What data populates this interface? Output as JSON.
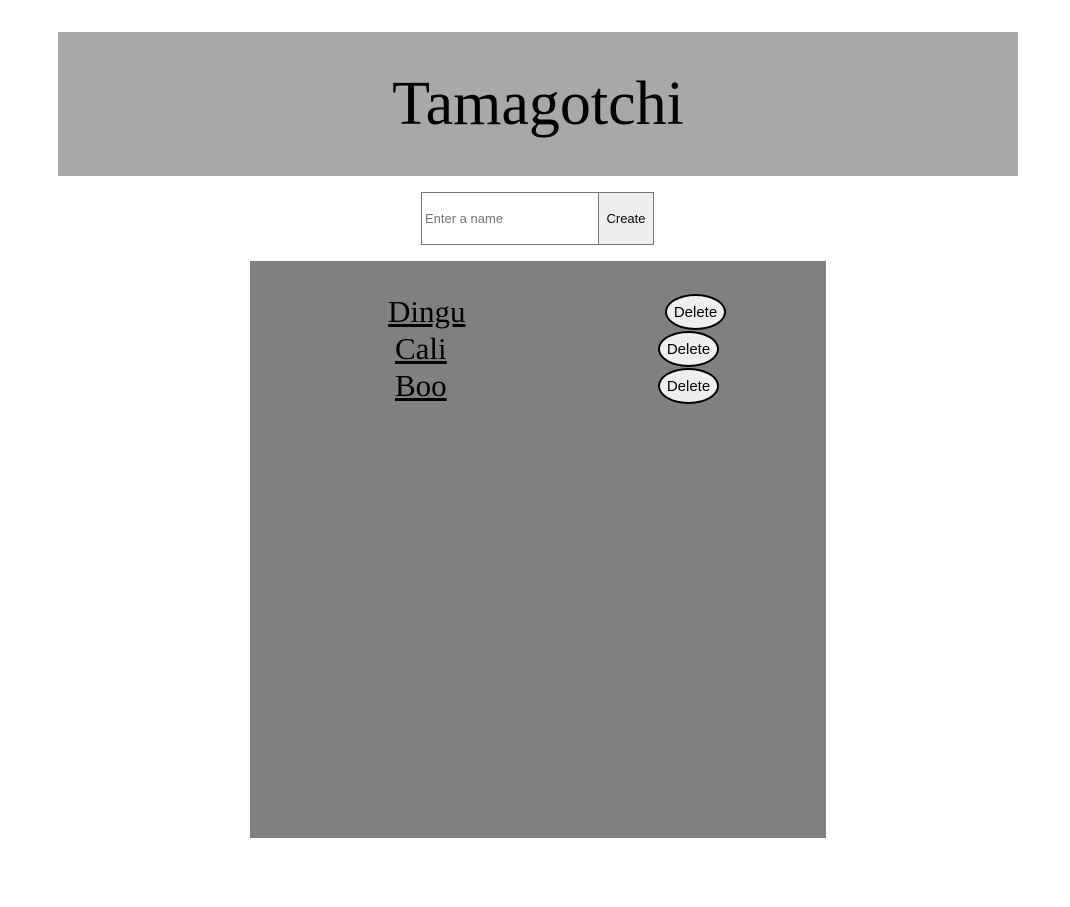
{
  "header": {
    "title": "Tamagotchi"
  },
  "create_form": {
    "input_placeholder": "Enter a name",
    "input_value": "",
    "button_label": "Create"
  },
  "pets": [
    {
      "name": "Dingu",
      "delete_label": "Delete"
    },
    {
      "name": "Cali",
      "delete_label": "Delete"
    },
    {
      "name": "Boo",
      "delete_label": "Delete"
    }
  ],
  "colors": {
    "header_background": "#a8a8a8",
    "panel_background": "#808080",
    "page_background": "#ffffff"
  }
}
